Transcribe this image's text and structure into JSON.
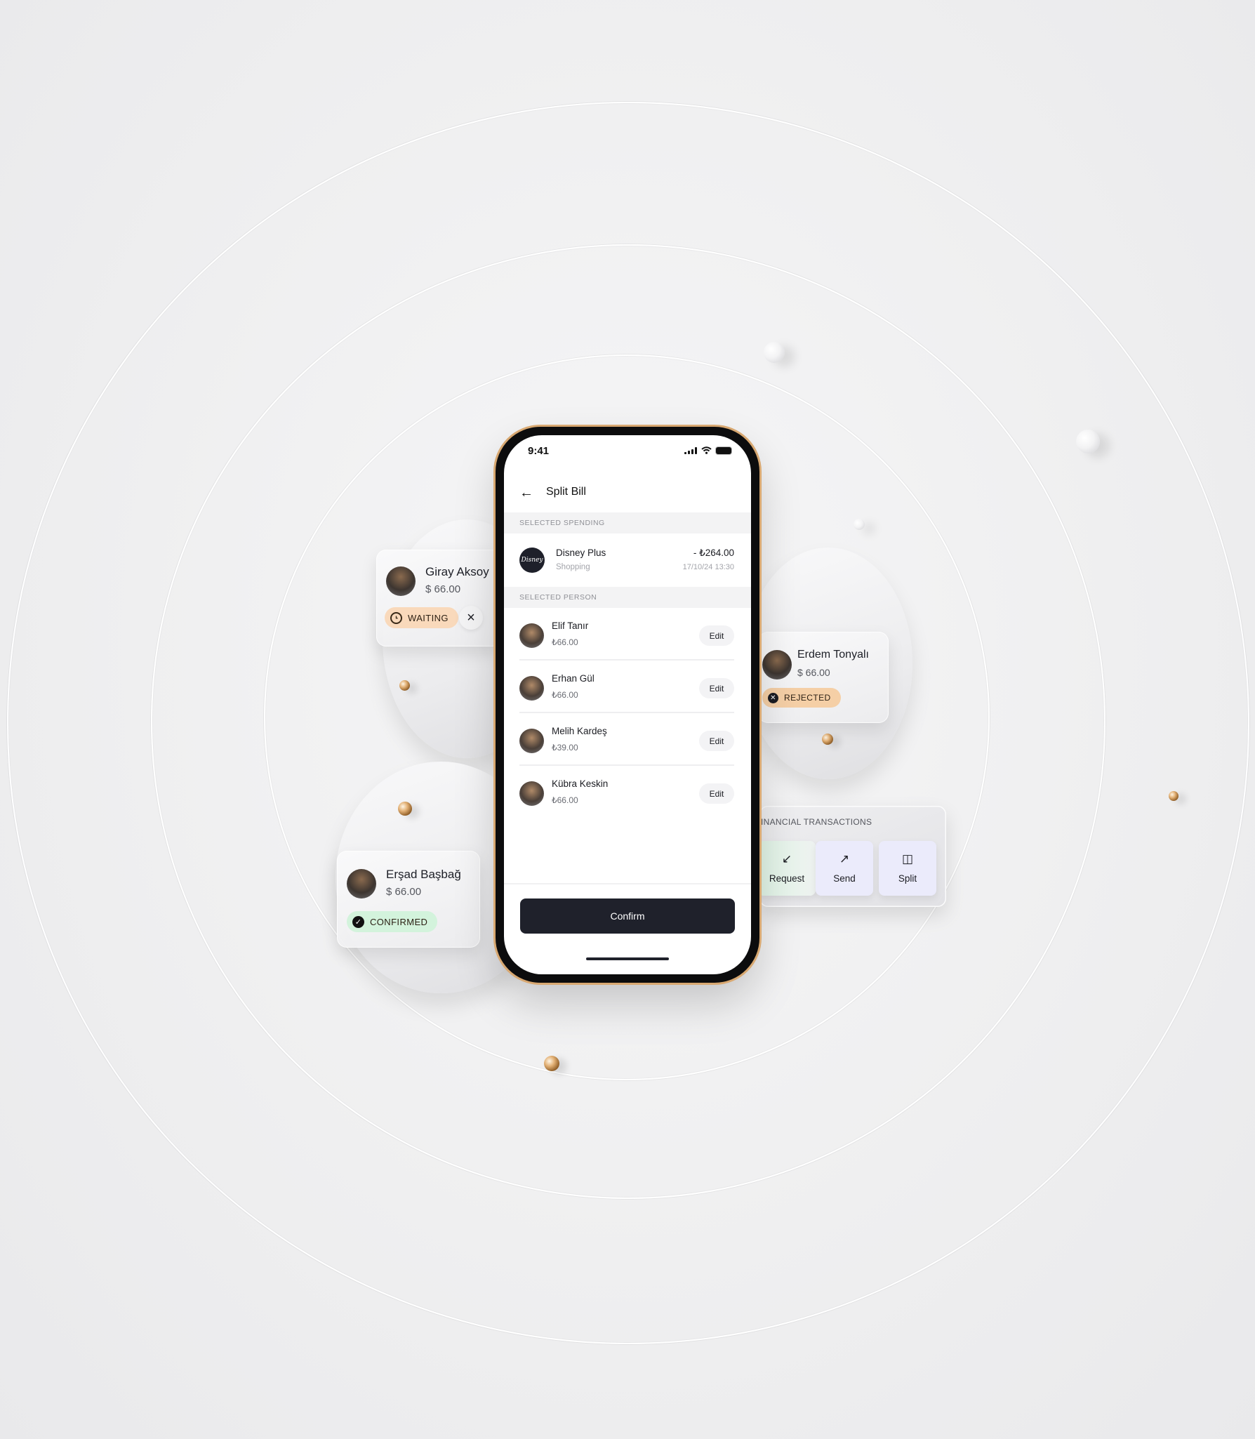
{
  "phone": {
    "status_bar": {
      "time": "9:41",
      "icons": [
        "cellular-signal-icon",
        "wifi-icon",
        "battery-icon"
      ]
    },
    "header": {
      "back_icon": "arrow-left-icon",
      "title": "Split Bill"
    },
    "selected_spending": {
      "section_label": "SELECTED SPENDING",
      "merchant": "Disney Plus",
      "logo_text": "Disney",
      "category": "Shopping",
      "amount": "- ₺264.00",
      "datetime": "17/10/24 13:30"
    },
    "selected_person": {
      "section_label": "SELECTED PERSON",
      "people": [
        {
          "name": "Elif Tanır",
          "amount": "₺66.00",
          "action": "Edit"
        },
        {
          "name": "Erhan Gül",
          "amount": "₺66.00",
          "action": "Edit"
        },
        {
          "name": "Melih Kardeş",
          "amount": "₺39.00",
          "action": "Edit"
        },
        {
          "name": "Kübra Keskin",
          "amount": "₺66.00",
          "action": "Edit"
        }
      ]
    },
    "confirm_label": "Confirm"
  },
  "floating_cards": {
    "giray": {
      "name": "Giray Aksoy",
      "amount": "$ 66.00",
      "status": "WAITING",
      "status_icon": "clock-icon",
      "status_color": "#f9d9bb",
      "close_icon": "×"
    },
    "erdem": {
      "name": "Erdem Tonyalı",
      "amount": "$ 66.00",
      "status": "REJECTED",
      "status_icon": "x-circle-icon",
      "status_color": "#f5cfa6"
    },
    "ersad": {
      "name": "Erşad Başbağ",
      "amount": "$ 66.00",
      "status": "CONFIRMED",
      "status_icon": "check-circle-icon",
      "status_color": "#d3f3dc"
    }
  },
  "financial_transactions": {
    "title": "INANCIAL TRANSACTIONS",
    "actions": [
      {
        "label": "Request",
        "icon": "↙"
      },
      {
        "label": "Send",
        "icon": "↗"
      },
      {
        "label": "Split",
        "icon": "◫"
      }
    ]
  }
}
